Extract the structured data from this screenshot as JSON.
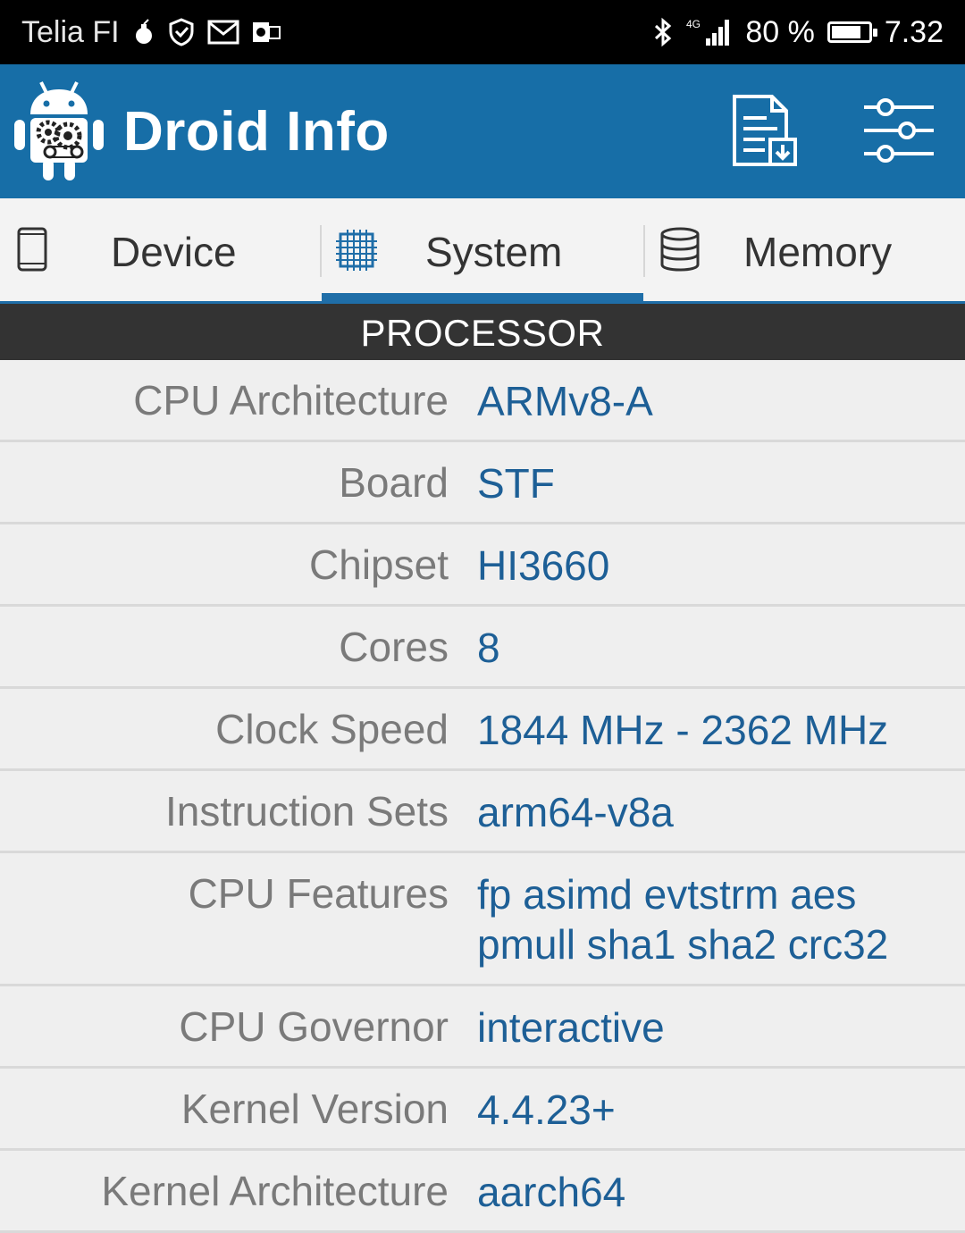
{
  "status_bar": {
    "carrier": "Telia FI",
    "network": "4G",
    "battery_percent": "80 %",
    "battery_level": 0.8,
    "time": "7.32",
    "icons": [
      "bomb-icon",
      "shield-icon",
      "gmail-icon",
      "outlook-icon",
      "bluetooth-icon",
      "signal-icon",
      "battery-icon"
    ]
  },
  "app_bar": {
    "title": "Droid Info",
    "background_color": "#176ea7",
    "actions": [
      "report-icon",
      "settings-sliders-icon"
    ]
  },
  "tabs": [
    {
      "label": "Device",
      "icon": "phone-icon",
      "selected": false
    },
    {
      "label": "System",
      "icon": "chip-icon",
      "selected": true
    },
    {
      "label": "Memory",
      "icon": "database-icon",
      "selected": false
    }
  ],
  "section_title": "PROCESSOR",
  "rows": [
    {
      "label": "CPU Architecture",
      "value": "ARMv8-A"
    },
    {
      "label": "Board",
      "value": "STF"
    },
    {
      "label": "Chipset",
      "value": "HI3660"
    },
    {
      "label": "Cores",
      "value": "8"
    },
    {
      "label": "Clock Speed",
      "value": "1844 MHz - 2362 MHz"
    },
    {
      "label": "Instruction Sets",
      "value": "arm64-v8a"
    },
    {
      "label": "CPU Features",
      "value": "fp asimd evtstrm aes",
      "value_line2": "pmull sha1 sha2 crc32"
    },
    {
      "label": "CPU Governor",
      "value": "interactive"
    },
    {
      "label": "Kernel Version",
      "value": "4.4.23+"
    },
    {
      "label": "Kernel Architecture",
      "value": "aarch64"
    }
  ],
  "colors": {
    "accent": "#1f6ea8",
    "value_text": "#1d5f96",
    "label_text": "#7a7a7a",
    "section_bg": "#333333"
  }
}
